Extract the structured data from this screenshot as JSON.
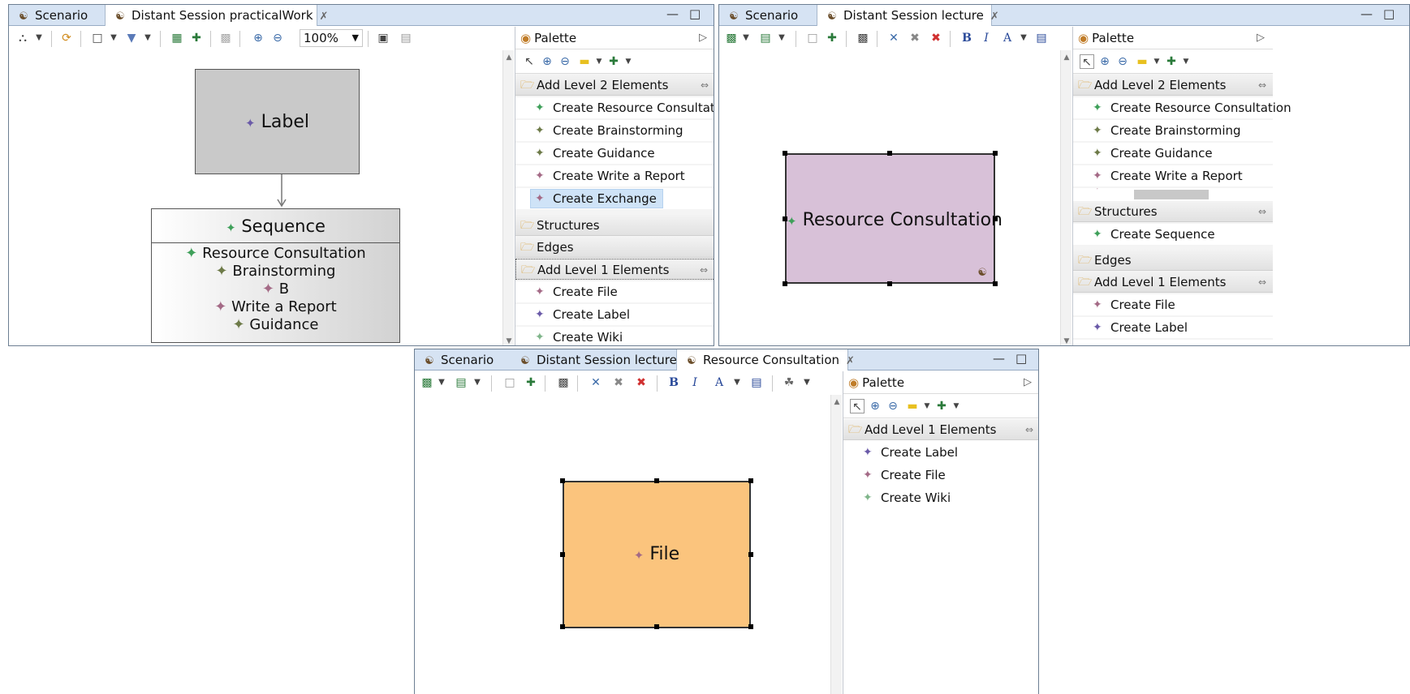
{
  "colors": {
    "tab_bar": "#d6e3f3",
    "selected_entry": "#cfe3f7",
    "label_node": "#c9c9c9",
    "resource_node": "#d8c1d8",
    "file_node": "#fbc47d",
    "green_star": "#3fa05a",
    "purple_star": "#6a5aa8",
    "mauve_star": "#a46a86",
    "olive_star": "#6d7a48"
  },
  "left_editor": {
    "tabs": [
      {
        "label": "Scenario",
        "icon": "diagram-icon",
        "active": false
      },
      {
        "label": "Distant Session practicalWork",
        "icon": "diagram-icon",
        "active": true
      }
    ],
    "zoom": "100%",
    "palette": {
      "title": "Palette",
      "drawers": [
        {
          "label": "Add Level 2 Elements",
          "entries": [
            "Create Resource Consultation",
            "Create Brainstorming",
            "Create Guidance",
            "Create Write a Report",
            "Create Exchange"
          ]
        },
        {
          "label": "Structures",
          "entries": []
        },
        {
          "label": "Edges",
          "entries": []
        },
        {
          "label": "Add Level 1 Elements",
          "entries": [
            "Create File",
            "Create Label",
            "Create Wiki"
          ]
        }
      ]
    },
    "diagram": {
      "label_node": "Label",
      "sequence_title": "Sequence",
      "sequence_items": [
        "Resource Consultation",
        "Brainstorming",
        "B",
        "Write a Report",
        "Guidance"
      ]
    }
  },
  "right_editor": {
    "tabs": [
      {
        "label": "Scenario",
        "icon": "diagram-icon",
        "active": false
      },
      {
        "label": "Distant Session lecture",
        "icon": "diagram-icon",
        "active": true
      }
    ],
    "palette": {
      "title": "Palette",
      "drawers": [
        {
          "label": "Add Level 2 Elements",
          "entries": [
            "Create Resource Consultation",
            "Create Brainstorming",
            "Create Guidance",
            "Create Write a Report"
          ]
        },
        {
          "label": "Structures",
          "entries": [
            "Create Sequence"
          ]
        },
        {
          "label": "Edges",
          "entries": []
        },
        {
          "label": "Add Level 1 Elements",
          "entries": [
            "Create File",
            "Create Label"
          ]
        }
      ]
    },
    "diagram": {
      "node": "Resource Consultation"
    }
  },
  "bottom_editor": {
    "tabs": [
      {
        "label": "Scenario",
        "icon": "diagram-icon",
        "active": false
      },
      {
        "label": "Distant Session lecture",
        "icon": "diagram-icon",
        "active": false
      },
      {
        "label": "Resource Consultation",
        "icon": "diagram-icon",
        "active": true
      }
    ],
    "palette": {
      "title": "Palette",
      "drawers": [
        {
          "label": "Add Level 1 Elements",
          "entries": [
            "Create Label",
            "Create File",
            "Create Wiki"
          ]
        }
      ]
    },
    "diagram": {
      "node": "File"
    }
  }
}
